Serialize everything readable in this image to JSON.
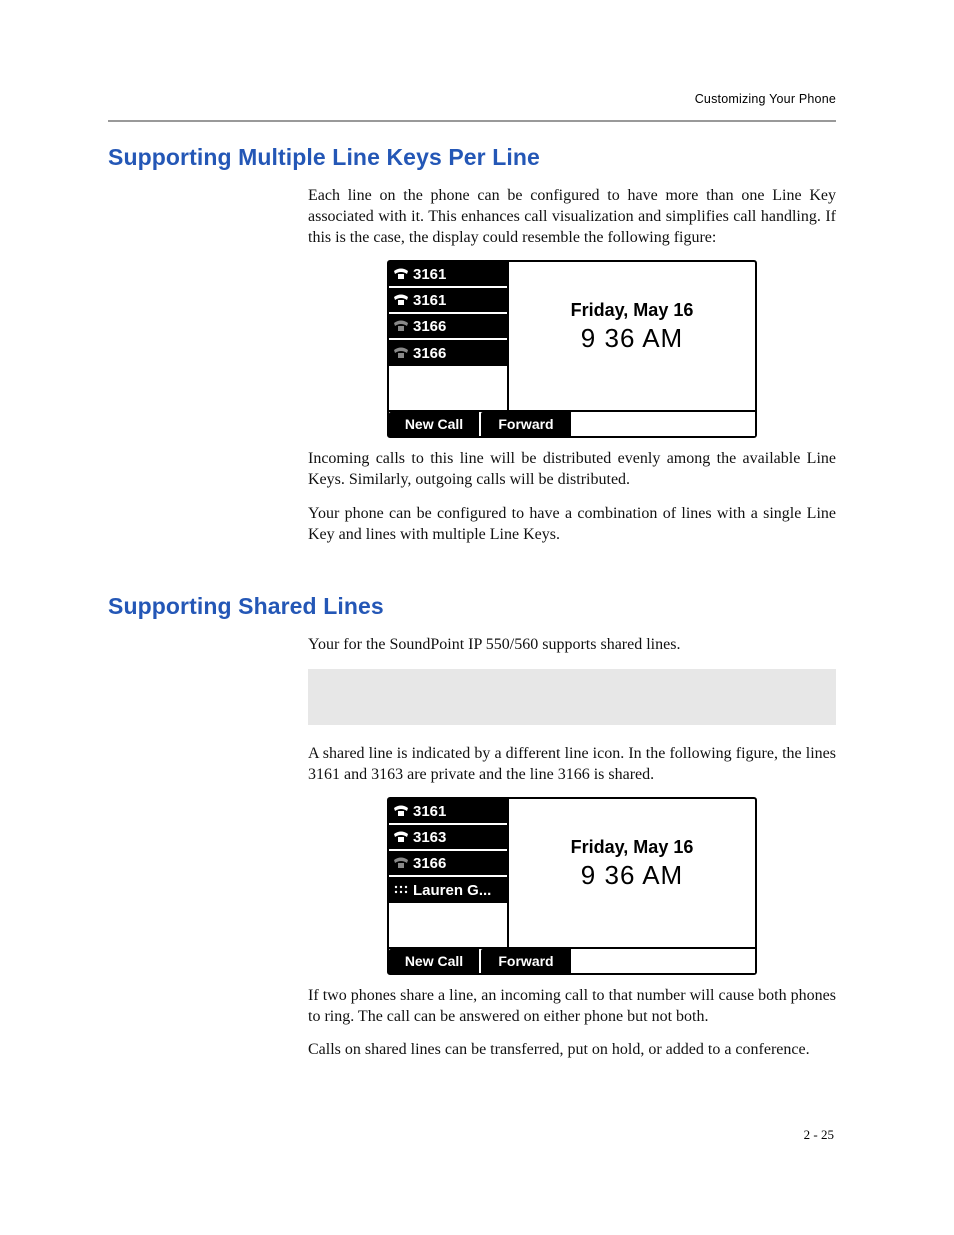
{
  "runningHead": "Customizing Your Phone",
  "pageNumber": "2 - 25",
  "section1": {
    "title": "Supporting Multiple Line Keys Per Line",
    "para1": "Each line on the phone can be configured to have more than one Line Key associated with it. This enhances call visualization and simplifies call handling. If this is the case, the display could resemble the following figure:",
    "para2": "Incoming calls to this line will be distributed evenly among the available Line Keys. Similarly, outgoing calls will be distributed.",
    "para3": "Your phone can be configured to have a combination of lines with a single Line Key and lines with multiple Line Keys."
  },
  "section2": {
    "title": "Supporting Shared Lines",
    "para1": "Your for the SoundPoint IP 550/560 supports shared lines.",
    "para2": "A shared line is indicated by a different line icon. In the following figure, the lines 3161 and 3163 are private and the line 3166 is shared.",
    "para3": "If two phones share a line, an incoming call to that number will cause both phones to ring. The call can be answered on either phone but not both.",
    "para4": "Calls on shared lines can be transferred, put on hold, or added to a conference."
  },
  "figure1": {
    "lines": [
      {
        "icon": "phone",
        "label": "3161"
      },
      {
        "icon": "phone",
        "label": "3161"
      },
      {
        "icon": "phone-dim",
        "label": "3166"
      },
      {
        "icon": "phone-dim",
        "label": "3166"
      }
    ],
    "date": "Friday, May 16",
    "time": "9 36 AM",
    "softkeys": [
      "New Call",
      "Forward"
    ]
  },
  "figure2": {
    "lines": [
      {
        "icon": "phone",
        "label": "3161"
      },
      {
        "icon": "phone",
        "label": "3163"
      },
      {
        "icon": "phone-dim",
        "label": "3166"
      },
      {
        "icon": "contact",
        "label": "Lauren G..."
      }
    ],
    "date": "Friday, May 16",
    "time": "9 36 AM",
    "softkeys": [
      "New Call",
      "Forward"
    ]
  }
}
